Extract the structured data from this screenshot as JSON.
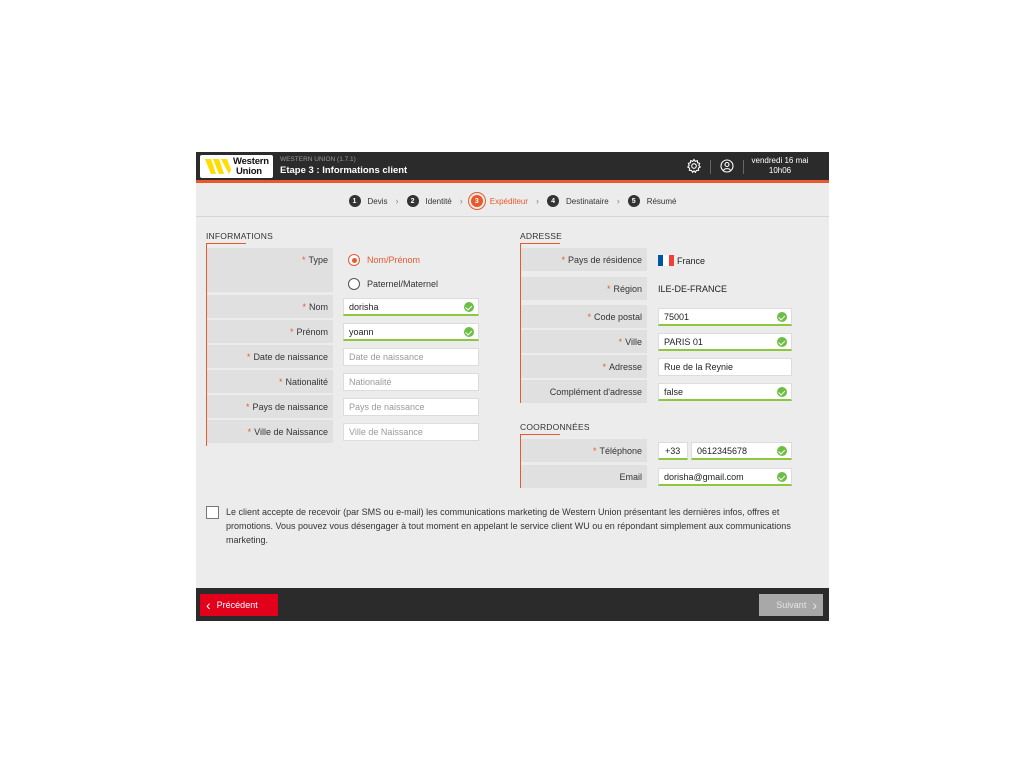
{
  "header": {
    "logo_line1": "Western",
    "logo_line2": "Union",
    "version": "WESTERN UNION (1.7.1)",
    "step_title": "Etape 3 : Informations client",
    "date_line1": "vendredi 16 mai",
    "date_line2": "10h06",
    "icons": [
      "gear-icon",
      "support-icon"
    ]
  },
  "stepper": {
    "steps": [
      {
        "num": "1",
        "label": "Devis"
      },
      {
        "num": "2",
        "label": "Identité"
      },
      {
        "num": "3",
        "label": "Expéditeur",
        "active": true
      },
      {
        "num": "4",
        "label": "Destinataire"
      },
      {
        "num": "5",
        "label": "Résumé"
      }
    ],
    "separator": "›"
  },
  "informations": {
    "title": "Informations",
    "type_label": "Type",
    "type_options": [
      "Nom/Prénom",
      "Paternel/Maternel"
    ],
    "type_selected": "Nom/Prénom",
    "nom_label": "Nom",
    "nom_value": "dorisha",
    "prenom_label": "Prénom",
    "prenom_value": "yoann",
    "date_label": "Date de naissance",
    "date_placeholder": "Date de naissance",
    "nationalite_label": "Nationalité",
    "nationalite_placeholder": "Nationalité",
    "pays_naissance_label": "Pays de naissance",
    "pays_naissance_placeholder": "Pays de naissance",
    "ville_naissance_label": "Ville de Naissance",
    "ville_naissance_placeholder": "Ville de Naissance"
  },
  "adresse": {
    "title": "Adresse",
    "pays_label": "Pays de résidence",
    "pays_value": "France",
    "region_label": "Région",
    "region_value": "ILE-DE-FRANCE",
    "cp_label": "Code postal",
    "cp_value": "75001",
    "ville_label": "Ville",
    "ville_value": "PARIS 01",
    "adresse_label": "Adresse",
    "adresse_value": "Rue de la Reynie",
    "complement_label": "Complément d'adresse",
    "complement_value": "false"
  },
  "coordonnees": {
    "title": "Coordonnées",
    "tel_label": "Téléphone",
    "tel_prefix": "+33",
    "tel_value": "0612345678",
    "email_label": "Email",
    "email_value": "dorisha@gmail.com"
  },
  "consent": {
    "text": "Le client accepte de recevoir (par SMS ou e-mail) les communications marketing de Western Union présentant les dernières infos, offres et promotions. Vous pouvez vous désengager à tout moment en appelant le service client WU ou en répondant simplement aux communications marketing.",
    "checked": false
  },
  "footer": {
    "prev_label": "Précédent",
    "next_label": "Suivant"
  },
  "colors": {
    "accent": "#e8592c",
    "prev_button": "#e3001b",
    "valid": "#6cbe45",
    "dark": "#2b2b2b"
  }
}
